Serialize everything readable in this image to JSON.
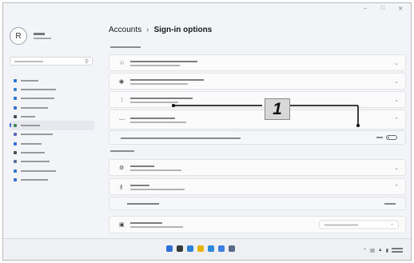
{
  "window": {
    "title": "",
    "controls": [
      "–",
      "□",
      "✕"
    ]
  },
  "profile": {
    "avatar_glyph": "R"
  },
  "sidebar": {
    "items": [
      {
        "color": "#2f6fd8"
      },
      {
        "color": "#3c82d5"
      },
      {
        "color": "#2f6fd8"
      },
      {
        "color": "#2f6fd8"
      },
      {
        "color": "#444c5a"
      },
      {
        "color": "#3b8a5a",
        "active": true
      },
      {
        "color": "#5b69b8"
      },
      {
        "color": "#2f6fd8"
      },
      {
        "color": "#4e4e4e"
      },
      {
        "color": "#5a6f9a"
      },
      {
        "color": "#3277c9"
      },
      {
        "color": "#2f6fd8"
      }
    ]
  },
  "breadcrumb": {
    "parent": "Accounts",
    "separator": "›",
    "current": "Sign-in options"
  },
  "callout": {
    "label": "1"
  },
  "icons": {
    "search": "magnifier-icon",
    "chevron": "chevron-right-icon",
    "dropdown": "chevron-down-icon"
  },
  "colors": {
    "accent": "#2b6bd3",
    "callout_bg": "#d8d8d8"
  }
}
